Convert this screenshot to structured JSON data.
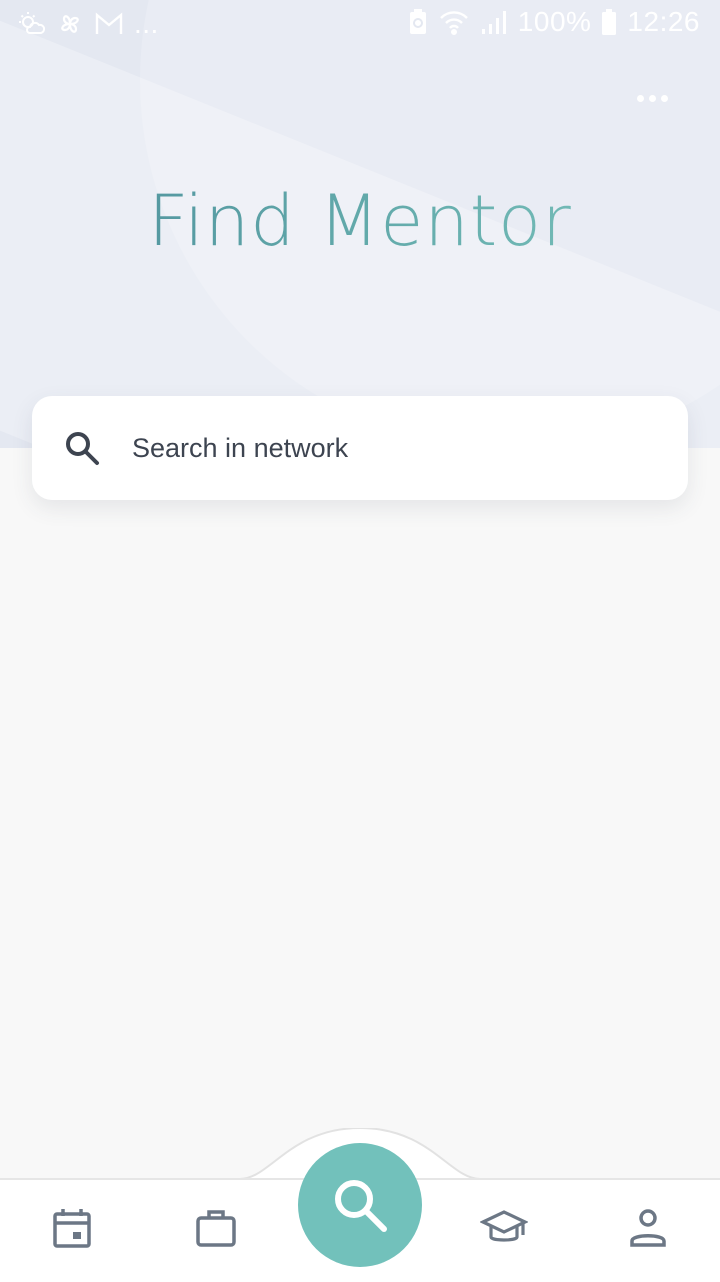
{
  "status_bar": {
    "battery": "100%",
    "time": "12:26",
    "left_icons": [
      "weather-icon",
      "pinwheel-icon",
      "gmail-icon",
      "more-notifications-dots"
    ],
    "right_icons": [
      "battery-saver-icon",
      "wifi-icon",
      "signal-icon",
      "battery-icon"
    ]
  },
  "header": {
    "title": "Find Mentor",
    "menu_icon": "more-dots-icon"
  },
  "search": {
    "placeholder": "Search in network",
    "icon": "search-icon"
  },
  "bottom_nav": {
    "items": [
      {
        "icon": "calendar-icon"
      },
      {
        "icon": "briefcase-icon"
      },
      {
        "icon": "search-icon",
        "active": true
      },
      {
        "icon": "graduation-cap-icon"
      },
      {
        "icon": "person-icon"
      }
    ]
  },
  "colors": {
    "accent": "#72c1bb",
    "title_gradient_start": "#4b8d9a",
    "title_gradient_end": "#7cc4bd",
    "nav_icon": "#6c7785"
  }
}
